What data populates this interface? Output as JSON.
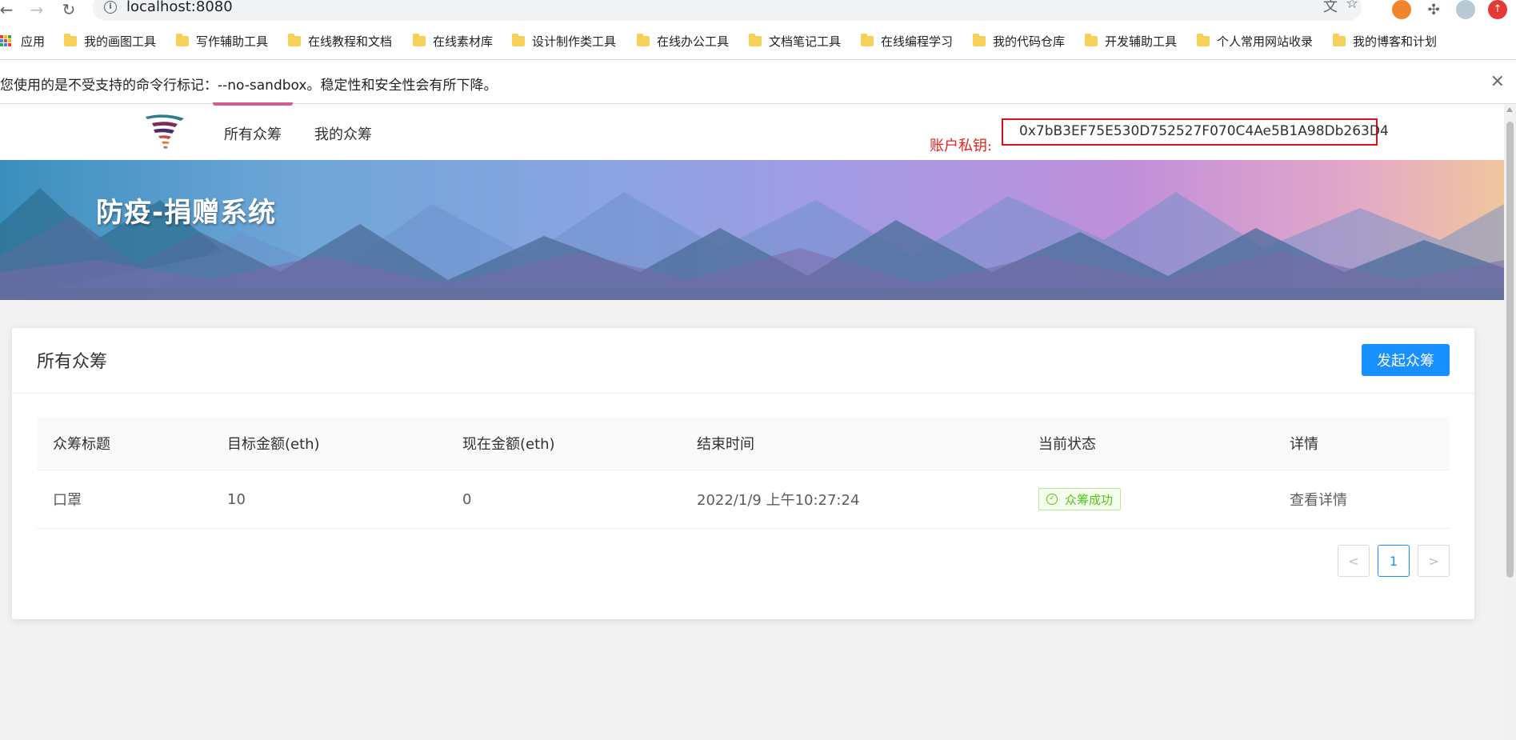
{
  "browser": {
    "url": "localhost:8080",
    "apps_label": "应用",
    "bookmarks": [
      "我的画图工具",
      "写作辅助工具",
      "在线教程和文档",
      "在线素材库",
      "设计制作类工具",
      "在线办公工具",
      "文档笔记工具",
      "在线编程学习",
      "我的代码仓库",
      "开发辅助工具",
      "个人常用网站收录",
      "我的博客和计划"
    ],
    "infobar_text": "您使用的是不受支持的命令行标记：--no-sandbox。稳定性和安全性会有所下降。",
    "infobar_close": "×"
  },
  "header": {
    "nav": [
      "所有众筹",
      "我的众筹"
    ],
    "key_label": "账户私钥:",
    "key_value": "0x7bB3EF75E530D752527F070C4Ae5B1A98Db263D4"
  },
  "banner": {
    "title": "防疫-捐赠系统"
  },
  "card": {
    "title": "所有众筹",
    "create_button": "发起众筹",
    "columns": [
      "众筹标题",
      "目标金额(eth)",
      "现在金额(eth)",
      "结束时间",
      "当前状态",
      "详情"
    ],
    "rows": [
      {
        "title": "口罩",
        "target": "10",
        "current": "0",
        "end_time": "2022/1/9 上午10:27:24",
        "status": "众筹成功",
        "detail": "查看详情"
      }
    ],
    "pagination": {
      "prev": "<",
      "current": "1",
      "next": ">"
    }
  },
  "colors": {
    "primary": "#1890ff",
    "success": "#52c41a",
    "key_border": "#e0101a",
    "nav_accent": "#d05f90"
  }
}
